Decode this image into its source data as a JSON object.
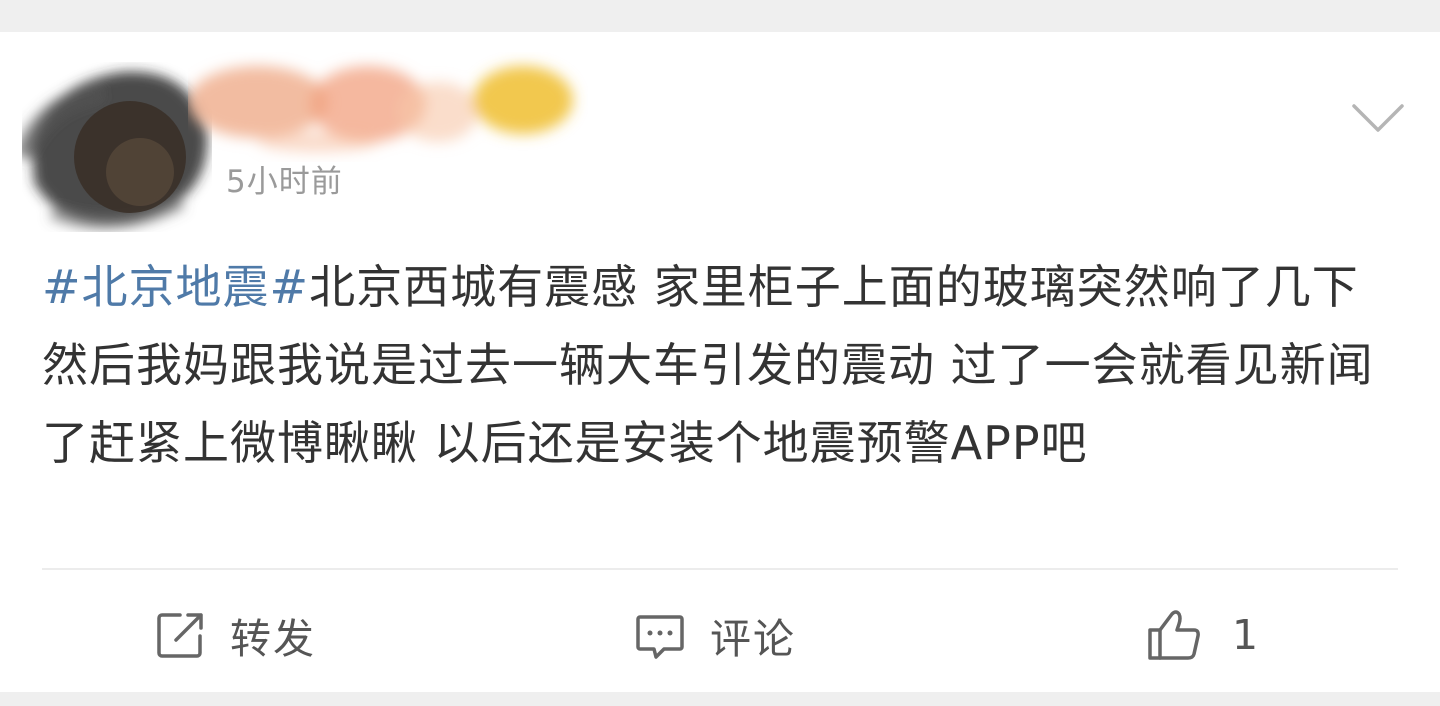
{
  "post": {
    "timestamp": "5小时前",
    "text_hashtag": "#北京地震#",
    "text_body": "北京西城有震感 家里柜子上面的玻璃突然响了几下  然后我妈跟我说是过去一辆大车引发的震动 过了一会就看见新闻了赶紧上微博瞅瞅 以后还是安装个地震预警APP吧"
  },
  "actions": {
    "repost_label": "转发",
    "comment_label": "评论",
    "like_count": "1"
  },
  "icons": {
    "more": "chevron-down-icon",
    "repost": "share-icon",
    "comment": "comment-icon",
    "like": "thumbs-up-icon"
  },
  "colors": {
    "hashtag": "#4f7aa8",
    "text": "#333333",
    "timestamp": "#9a9a9a",
    "background": "#efefef"
  }
}
